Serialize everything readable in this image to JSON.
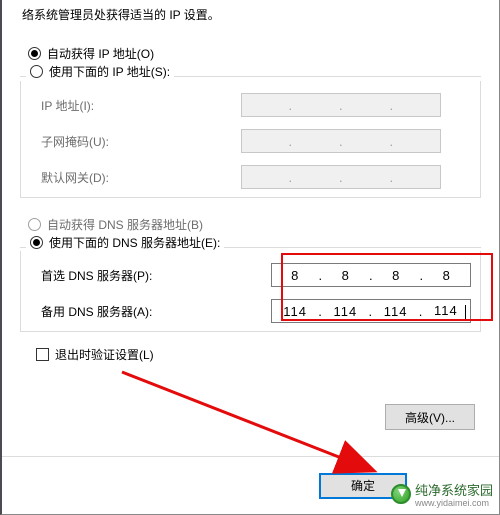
{
  "info_text": "络系统管理员处获得适当的 IP 设置。",
  "ip_section": {
    "auto_label": "自动获得 IP 地址(O)",
    "manual_label": "使用下面的 IP 地址(S):",
    "fields": {
      "ip_label": "IP 地址(I):",
      "mask_label": "子网掩码(U):",
      "gateway_label": "默认网关(D):"
    }
  },
  "dns_section": {
    "auto_label": "自动获得 DNS 服务器地址(B)",
    "manual_label": "使用下面的 DNS 服务器地址(E):",
    "preferred_label": "首选 DNS 服务器(P):",
    "alternate_label": "备用 DNS 服务器(A):",
    "preferred": {
      "o1": "8",
      "o2": "8",
      "o3": "8",
      "o4": "8"
    },
    "alternate": {
      "o1": "114",
      "o2": "114",
      "o3": "114",
      "o4": "114"
    }
  },
  "validate_label": "退出时验证设置(L)",
  "advanced_label": "高级(V)...",
  "ok_label": "确定",
  "watermark": {
    "title": "纯净系统家园",
    "url": "www.yidaimei.com"
  }
}
